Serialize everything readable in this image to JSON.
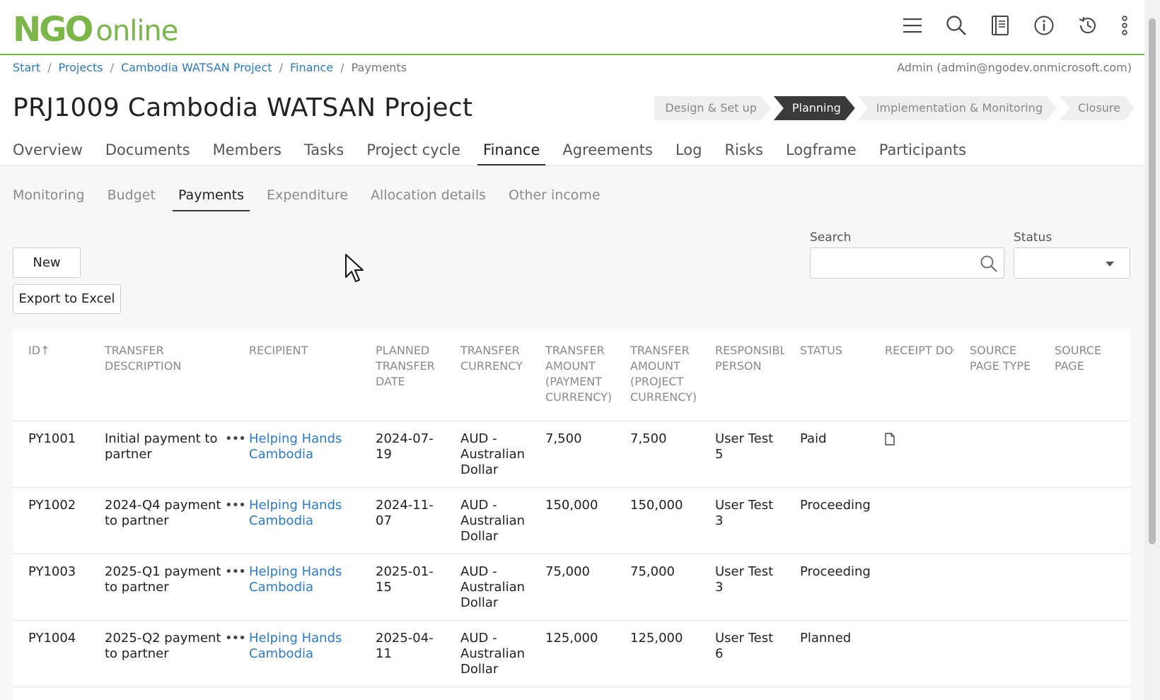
{
  "app": {
    "logo_ngo": "NGO",
    "logo_online": "online",
    "user": "Admin (admin@ngodev.onmicrosoft.com)",
    "icons": [
      "menu-icon",
      "search-icon",
      "book-icon",
      "info-icon",
      "history-icon",
      "more-vertical-icon"
    ],
    "accent": "#7ab648",
    "link_color": "#2a7bc9"
  },
  "breadcrumb": [
    "Start",
    "Projects",
    "Cambodia WATSAN Project",
    "Finance",
    "Payments"
  ],
  "title": "PRJ1009 Cambodia WATSAN Project",
  "phases": [
    "Design & Set up",
    "Planning",
    "Implementation & Monitoring",
    "Closure"
  ],
  "active_phase": "Planning",
  "main_tabs": [
    "Overview",
    "Documents",
    "Members",
    "Tasks",
    "Project cycle",
    "Finance",
    "Agreements",
    "Log",
    "Risks",
    "Logframe",
    "Participants"
  ],
  "active_main_tab": "Finance",
  "sub_tabs": [
    "Monitoring",
    "Budget",
    "Payments",
    "Expenditure",
    "Allocation details",
    "Other income"
  ],
  "active_sub_tab": "Payments",
  "toolbar": {
    "new_label": "New",
    "export_label": "Export to Excel",
    "search_label": "Search",
    "search_value": "",
    "status_label": "Status",
    "status_value": ""
  },
  "table": {
    "columns": [
      "ID↑",
      "Transfer description",
      "Recipient",
      "Planned transfer date",
      "Transfer currency",
      "Transfer amount (payment currency)",
      "Transfer amount (project currency)",
      "Responsible person",
      "Status",
      "Receipt document(s)",
      "Source page type",
      "Source page"
    ],
    "rows": [
      {
        "id": "PY1001",
        "description": "Initial payment to partner",
        "recipient": "Helping Hands Cambodia",
        "date": "2024-07-19",
        "currency": "AUD - Australian Dollar",
        "amount_payment": "7,500",
        "amount_project": "7,500",
        "person": "User Test 5",
        "status": "Paid",
        "receipt": "document-icon",
        "source_type": "",
        "source_page": ""
      },
      {
        "id": "PY1002",
        "description": "2024-Q4 payment to partner",
        "recipient": "Helping Hands Cambodia",
        "date": "2024-11-07",
        "currency": "AUD - Australian Dollar",
        "amount_payment": "150,000",
        "amount_project": "150,000",
        "person": "User Test 3",
        "status": "Proceeding",
        "receipt": "",
        "source_type": "",
        "source_page": ""
      },
      {
        "id": "PY1003",
        "description": "2025-Q1 payment to partner",
        "recipient": "Helping Hands Cambodia",
        "date": "2025-01-15",
        "currency": "AUD - Australian Dollar",
        "amount_payment": "75,000",
        "amount_project": "75,000",
        "person": "User Test 3",
        "status": "Proceeding",
        "receipt": "",
        "source_type": "",
        "source_page": ""
      },
      {
        "id": "PY1004",
        "description": "2025-Q2 payment to partner",
        "recipient": "Helping Hands Cambodia",
        "date": "2025-04-11",
        "currency": "AUD - Australian Dollar",
        "amount_payment": "125,000",
        "amount_project": "125,000",
        "person": "User Test 6",
        "status": "Planned",
        "receipt": "",
        "source_type": "",
        "source_page": ""
      }
    ]
  }
}
